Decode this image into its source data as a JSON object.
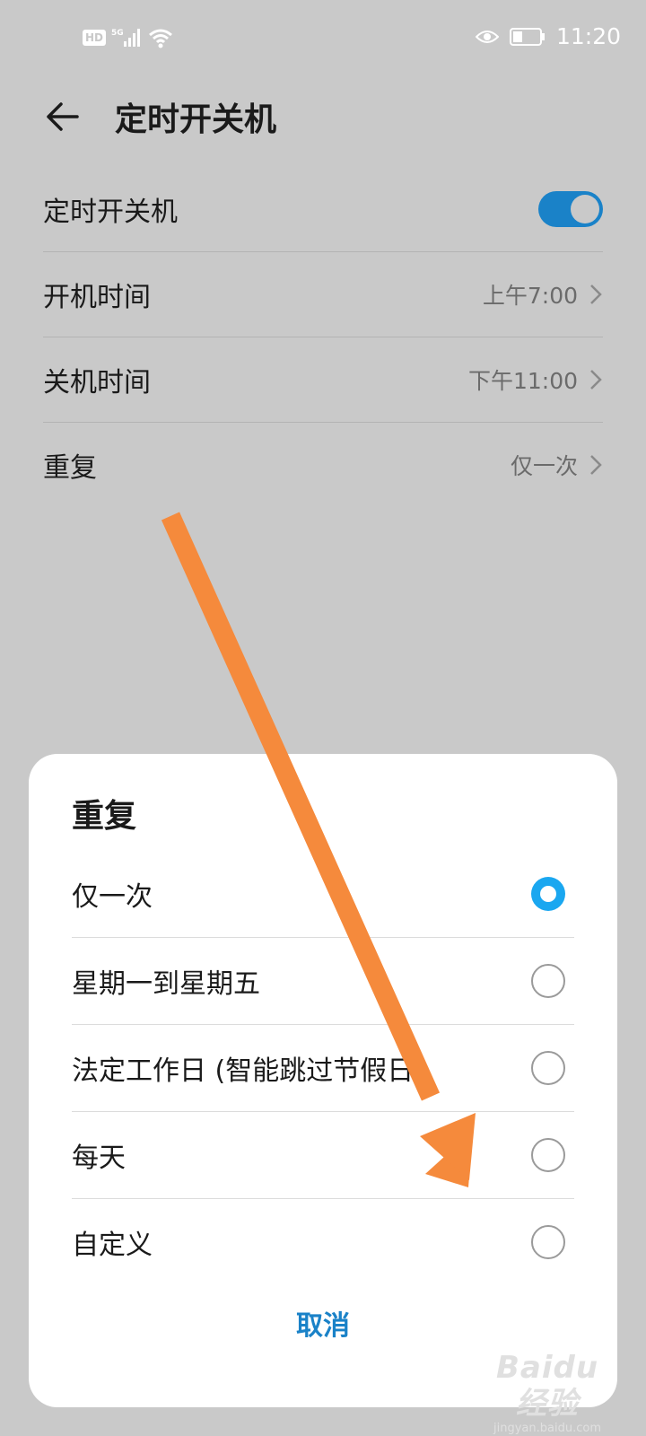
{
  "status_bar": {
    "hd_badge": "HD",
    "network_label": "5G",
    "icons": [
      "hd-badge",
      "signal-5g-icon",
      "wifi-icon",
      "eye-icon",
      "battery-icon"
    ],
    "time": "11:20"
  },
  "header": {
    "back_icon": "back-arrow-icon",
    "title": "定时开关机"
  },
  "settings": {
    "toggle_row": {
      "label": "定时开关机",
      "enabled": true,
      "accent": "#1a82c8"
    },
    "power_on": {
      "label": "开机时间",
      "value": "上午7:00"
    },
    "power_off": {
      "label": "关机时间",
      "value": "下午11:00"
    },
    "repeat": {
      "label": "重复",
      "value": "仅一次"
    }
  },
  "dialog": {
    "title": "重复",
    "options": [
      {
        "label": "仅一次",
        "selected": true
      },
      {
        "label": "星期一到星期五",
        "selected": false
      },
      {
        "label": "法定工作日 (智能跳过节假日)",
        "selected": false
      },
      {
        "label": "每天",
        "selected": false
      },
      {
        "label": "自定义",
        "selected": false
      }
    ],
    "cancel_label": "取消",
    "selected_color": "#1aa7f0"
  },
  "annotation": {
    "arrow_color": "#f58a3c"
  },
  "watermark": {
    "mark": "Baidu经验",
    "url": "jingyan.baidu.com"
  }
}
